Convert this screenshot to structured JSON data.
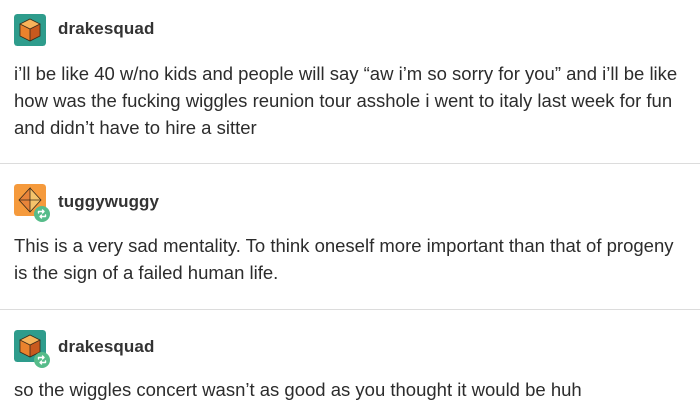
{
  "posts": [
    {
      "username": "drakesquad",
      "avatar_icon": "cube-avatar-icon",
      "text": "i’ll be like 40 w/no kids and people will say “aw i’m so sorry for you” and i’ll be like how was the fucking wiggles reunion tour asshole i went to italy last week for fun and didn’t have to hire a sitter"
    },
    {
      "username": "tuggywuggy",
      "avatar_icon": "geometric-avatar-icon",
      "reblog_icon": "reblog-icon",
      "text": "This is a very sad mentality. To think oneself more important than that of progeny is the sign of a failed human life."
    },
    {
      "username": "drakesquad",
      "avatar_icon": "cube-avatar-icon",
      "reblog_icon": "reblog-icon",
      "text": "so the wiggles concert wasn’t as good as you thought it would be huh"
    }
  ],
  "colors": {
    "text": "#2c2c2c",
    "divider": "#dcdcdc",
    "reblog_badge": "#56bc8a",
    "avatar_teal": "#2e9c8c",
    "avatar_orange": "#f59a3c"
  }
}
